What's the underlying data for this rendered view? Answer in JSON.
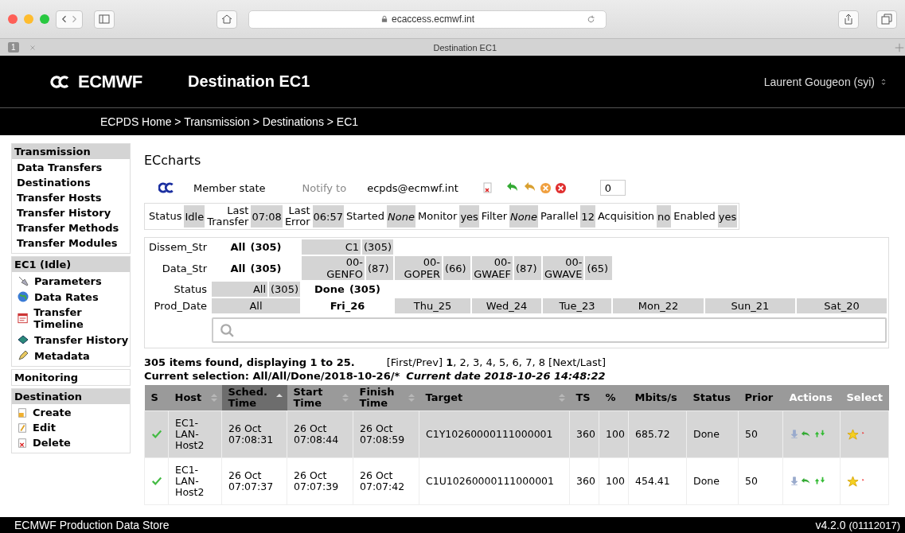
{
  "browser": {
    "url": "ecaccess.ecmwf.int",
    "tab_count": "1",
    "tab_title": "Destination EC1"
  },
  "header": {
    "logo": "ECMWF",
    "title": "Destination EC1",
    "user": "Laurent Gougeon (syi)"
  },
  "breadcrumb": "ECPDS Home > Transmission > Destinations > EC1",
  "sidebar": [
    {
      "title": "Transmission",
      "expanded": true,
      "items": [
        "Data Transfers",
        "Destinations",
        "Transfer Hosts",
        "Transfer History",
        "Transfer Methods",
        "Transfer Modules"
      ]
    },
    {
      "title": "EC1 (Idle)",
      "expanded": true,
      "items": [
        "Parameters",
        "Data Rates",
        "Transfer Timeline",
        "Transfer History",
        "Metadata"
      ]
    },
    {
      "title": "Monitoring",
      "expanded": false
    },
    {
      "title": "Destination",
      "expanded": true,
      "items": [
        "Create",
        "Edit",
        "Delete"
      ]
    }
  ],
  "destination": {
    "name": "ECcharts",
    "type": "Member state",
    "notify_label": "Notify to",
    "notify_email": "ecpds@ecmwf.int",
    "count_value": "0"
  },
  "status_bar": [
    {
      "label": "Status",
      "value": "Idle",
      "italic": false
    },
    {
      "label": "Last Transfer",
      "value": "07:08",
      "italic": false
    },
    {
      "label": "Last Error",
      "value": "06:57",
      "italic": false
    },
    {
      "label": "Started",
      "value": "None",
      "italic": true
    },
    {
      "label": "Monitor",
      "value": "yes",
      "italic": false
    },
    {
      "label": "Filter",
      "value": "None",
      "italic": true
    },
    {
      "label": "Parallel",
      "value": "12",
      "italic": false
    },
    {
      "label": "Acquisition",
      "value": "no",
      "italic": false
    },
    {
      "label": "Enabled",
      "value": "yes",
      "italic": false
    }
  ],
  "filters": [
    {
      "label": "Dissem_Str",
      "options": [
        {
          "label": "All",
          "count": "(305)",
          "selected": true
        },
        {
          "label": "C1",
          "count": "(305)",
          "selected": false
        }
      ]
    },
    {
      "label": "Data_Str",
      "options": [
        {
          "label": "All",
          "count": "(305)",
          "selected": true
        },
        {
          "label": "00-GENFO",
          "count": "(87)",
          "selected": false
        },
        {
          "label": "00-GOPER",
          "count": "(66)",
          "selected": false
        },
        {
          "label": "00-GWAEF",
          "count": "(87)",
          "selected": false
        },
        {
          "label": "00-GWAVE",
          "count": "(65)",
          "selected": false
        }
      ]
    },
    {
      "label": "Status",
      "options": [
        {
          "label": "All",
          "count": "(305)",
          "selected": false
        },
        {
          "label": "Done",
          "count": "(305)",
          "selected": true
        }
      ]
    },
    {
      "label": "Prod_Date",
      "options": [
        {
          "label": "All",
          "selected": false
        },
        {
          "label": "Fri_26",
          "selected": true
        },
        {
          "label": "Thu_25",
          "selected": false
        },
        {
          "label": "Wed_24",
          "selected": false
        },
        {
          "label": "Tue_23",
          "selected": false
        },
        {
          "label": "Mon_22",
          "selected": false
        },
        {
          "label": "Sun_21",
          "selected": false
        },
        {
          "label": "Sat_20",
          "selected": false
        }
      ]
    }
  ],
  "summary": "305 items found, displaying 1 to 25.",
  "pagination": "[First/Prev] **1**, 2, 3, 4, 5, 6, 7, 8 [Next/Last]",
  "current_selection": "Current selection: All/All/Done/2018-10-26/*",
  "current_date": "Current date 2018-10-26 14:48:22",
  "table": {
    "columns": [
      {
        "label": "S",
        "kind": "plain",
        "sortable": false,
        "selected": false
      },
      {
        "label": "Host",
        "kind": "plain",
        "sortable": true,
        "selected": false
      },
      {
        "label": "Sched. Time",
        "kind": "plain",
        "sortable": true,
        "selected": true
      },
      {
        "label": "Start Time",
        "kind": "plain",
        "sortable": true,
        "selected": false
      },
      {
        "label": "Finish Time",
        "kind": "plain",
        "sortable": true,
        "selected": false
      },
      {
        "label": "Target",
        "kind": "plain",
        "sortable": true,
        "selected": false
      },
      {
        "label": "TS",
        "kind": "plain",
        "sortable": false,
        "selected": false
      },
      {
        "label": "%",
        "kind": "plain",
        "sortable": false,
        "selected": false
      },
      {
        "label": "Mbits/s",
        "kind": "plain",
        "sortable": false,
        "selected": false
      },
      {
        "label": "Status",
        "kind": "plain",
        "sortable": false,
        "selected": false
      },
      {
        "label": "Prior",
        "kind": "plain",
        "sortable": false,
        "selected": false
      },
      {
        "label": "Actions",
        "kind": "action",
        "sortable": false,
        "selected": false
      },
      {
        "label": "Select",
        "kind": "action",
        "sortable": false,
        "selected": false
      }
    ],
    "rows": [
      {
        "selected": true,
        "done": true,
        "host": "EC1-LAN-Host2",
        "sched": "26 Oct 07:08:31",
        "start": "26 Oct 07:08:44",
        "finish": "26 Oct 07:08:59",
        "target": "C1Y10260000111000001",
        "ts": "360",
        "pct": "100",
        "rate": "685.72",
        "status": "Done",
        "prior": "50"
      },
      {
        "selected": false,
        "done": true,
        "host": "EC1-LAN-Host2",
        "sched": "26 Oct 07:07:37",
        "start": "26 Oct 07:07:39",
        "finish": "26 Oct 07:07:42",
        "target": "C1U10260000111000001",
        "ts": "360",
        "pct": "100",
        "rate": "454.41",
        "status": "Done",
        "prior": "50"
      }
    ]
  },
  "footer": {
    "left": "ECMWF Production Data Store",
    "version": "v4.2.0",
    "build": "(01112017)"
  }
}
